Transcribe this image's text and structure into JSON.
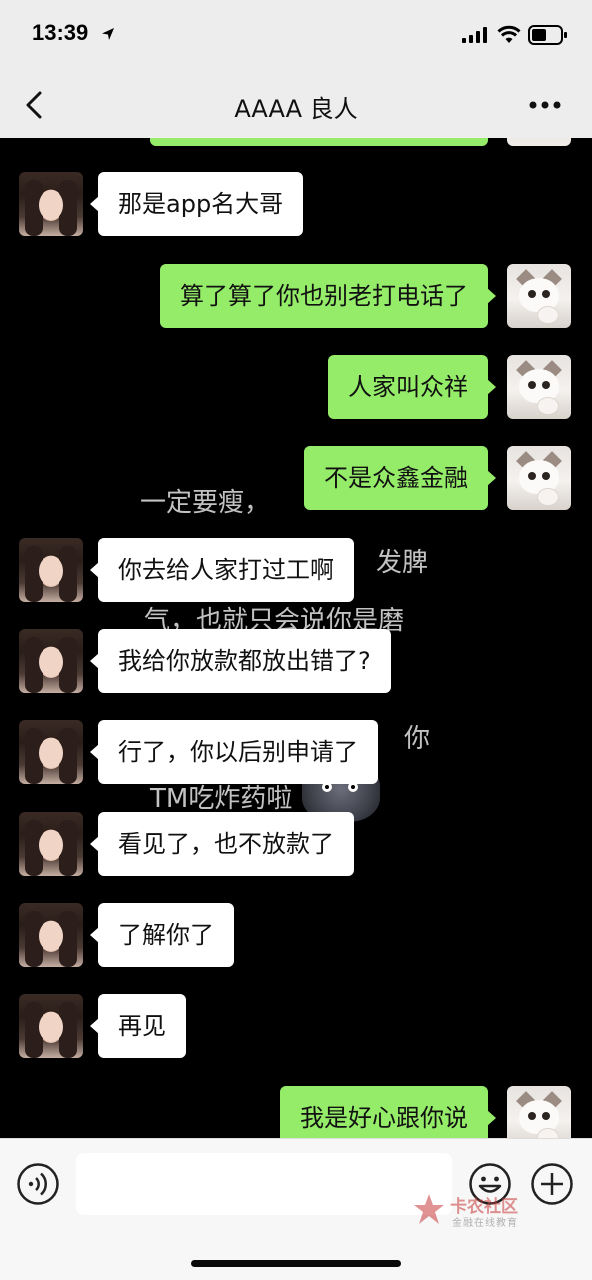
{
  "status_bar": {
    "time": "13:39"
  },
  "nav": {
    "title": "AAAA 良人"
  },
  "wallpaper_text": [
    "一定要瘦，",
    "发脾",
    "气，也就只会说你是磨",
    "你",
    "TM吃炸药啦"
  ],
  "messages": [
    {
      "side": "in",
      "text": "那是app名大哥",
      "avatar": "girl-avatar"
    },
    {
      "side": "out",
      "text": "算了算了你也别老打电话了",
      "avatar": "cat-avatar"
    },
    {
      "side": "out",
      "text": "人家叫众祥",
      "avatar": "cat-avatar"
    },
    {
      "side": "out",
      "text": "不是众鑫金融",
      "avatar": "cat-avatar"
    },
    {
      "side": "in",
      "text": "你去给人家打过工啊",
      "avatar": "girl-avatar"
    },
    {
      "side": "in",
      "text": "我给你放款都放出错了?",
      "avatar": "girl-avatar"
    },
    {
      "side": "in",
      "text": "行了，你以后别申请了",
      "avatar": "girl-avatar"
    },
    {
      "side": "in",
      "text": "看见了，也不放款了",
      "avatar": "girl-avatar"
    },
    {
      "side": "in",
      "text": "了解你了",
      "avatar": "girl-avatar"
    },
    {
      "side": "in",
      "text": "再见",
      "avatar": "girl-avatar"
    },
    {
      "side": "out",
      "text": "我是好心跟你说",
      "avatar": "cat-avatar"
    }
  ],
  "input_bar": {
    "value": "",
    "placeholder": ""
  },
  "watermark": {
    "title": "卡农社区",
    "subtitle": "金融在线教育"
  },
  "colors": {
    "outgoing_bubble": "#95ec69",
    "incoming_bubble": "#ffffff",
    "chat_background": "#000000",
    "header_background": "#ededed"
  },
  "icons": [
    "location-arrow-icon",
    "signal-icon",
    "wifi-icon",
    "battery-icon",
    "back-icon",
    "more-icon",
    "voice-icon",
    "emoji-icon",
    "plus-icon"
  ]
}
